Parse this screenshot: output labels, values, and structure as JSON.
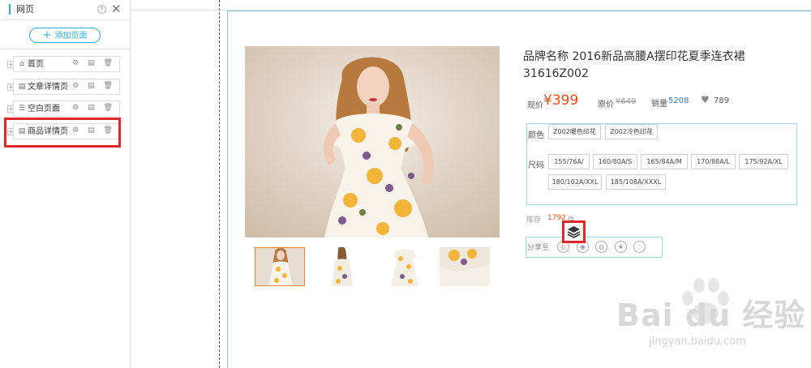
{
  "panel": {
    "title": "网页",
    "help_glyph": "?",
    "close_glyph": "✕",
    "add_button": {
      "plus": "+",
      "label": "添加页面"
    },
    "pages": [
      {
        "label": "首页",
        "icon": "home-icon",
        "glyph": "⌂",
        "tree": "+"
      },
      {
        "label": "文章详情页",
        "icon": "document-icon",
        "glyph": "▤",
        "tree": "+"
      },
      {
        "label": "空白页面",
        "icon": "list-icon",
        "glyph": "☰",
        "tree": "+"
      },
      {
        "label": "商品详情页",
        "icon": "document-icon",
        "glyph": "▤",
        "tree": "+"
      }
    ],
    "item_tools": "⚙ ▤ 🗑",
    "highlight_color": "#e2252c"
  },
  "product": {
    "title": "品牌名称 2016新品高腰A摆印花夏季连衣裙31616Z002",
    "current_price_label": "现价",
    "current_price": "¥399",
    "original_price_label": "原价",
    "original_price": "¥649",
    "sales_label": "销量",
    "sales_value": "5208",
    "likes": "789",
    "color_label": "颜色",
    "colors": [
      "Z002暖色印花",
      "Z002冷色印花"
    ],
    "size_label": "尺码",
    "sizes": [
      "155/76A/",
      "160/80A/S",
      "165/84A/M",
      "170/88A/L",
      "175/92A/XL",
      "180/102A/XXL",
      "185/108A/XXXL"
    ],
    "stock_label": "库存",
    "stock_value": "1792",
    "stock_unit": "件",
    "share_label": "分享至"
  },
  "colors": {
    "accent_blue": "#2aaee0",
    "price_orange": "#f04a10",
    "guide_blue": "#7dc8e6"
  },
  "watermark": {
    "brand": "Bai du 经验",
    "sub": "jingyan.baidu.com"
  }
}
